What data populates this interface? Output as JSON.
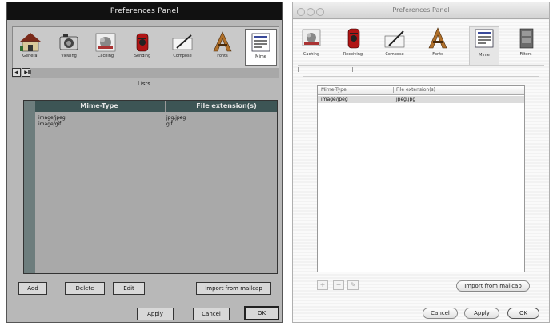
{
  "classic_window": {
    "title": "Preferences Panel",
    "toolbar": [
      {
        "id": "general",
        "label": "General"
      },
      {
        "id": "viewing",
        "label": "Viewing"
      },
      {
        "id": "caching",
        "label": "Caching"
      },
      {
        "id": "sending",
        "label": "Sending"
      },
      {
        "id": "compose",
        "label": "Compose"
      },
      {
        "id": "fonts",
        "label": "Fonts"
      },
      {
        "id": "mime",
        "label": "Mime",
        "selected": true
      }
    ],
    "group_title": "Lists",
    "table": {
      "columns": [
        "Mime-Type",
        "File extension(s)"
      ],
      "rows": [
        {
          "mime": "image/jpeg",
          "ext": "jpg,jpeg"
        },
        {
          "mime": "image/gif",
          "ext": "gif"
        }
      ]
    },
    "buttons": {
      "add": "Add",
      "delete": "Delete",
      "edit": "Edit",
      "import": "Import from mailcap"
    },
    "footer": {
      "apply": "Apply",
      "cancel": "Cancel",
      "ok": "OK"
    }
  },
  "aqua_window": {
    "title": "Preferences Panel",
    "toolbar": [
      {
        "id": "caching",
        "label": "Caching"
      },
      {
        "id": "receiving",
        "label": "Receiving"
      },
      {
        "id": "compose",
        "label": "Compose"
      },
      {
        "id": "fonts",
        "label": "Fonts"
      },
      {
        "id": "mime",
        "label": "Mime",
        "selected": true
      },
      {
        "id": "filters",
        "label": "Filters"
      }
    ],
    "table": {
      "columns": [
        "Mime-Type",
        "File extension(s)"
      ],
      "rows": [
        {
          "mime": "image/jpeg",
          "ext": "jpeg,jpg"
        }
      ]
    },
    "buttons": {
      "add": "+",
      "delete": "−",
      "edit": "✎",
      "import": "Import from mailcap"
    },
    "footer": {
      "cancel": "Cancel",
      "apply": "Apply",
      "ok": "OK"
    }
  }
}
